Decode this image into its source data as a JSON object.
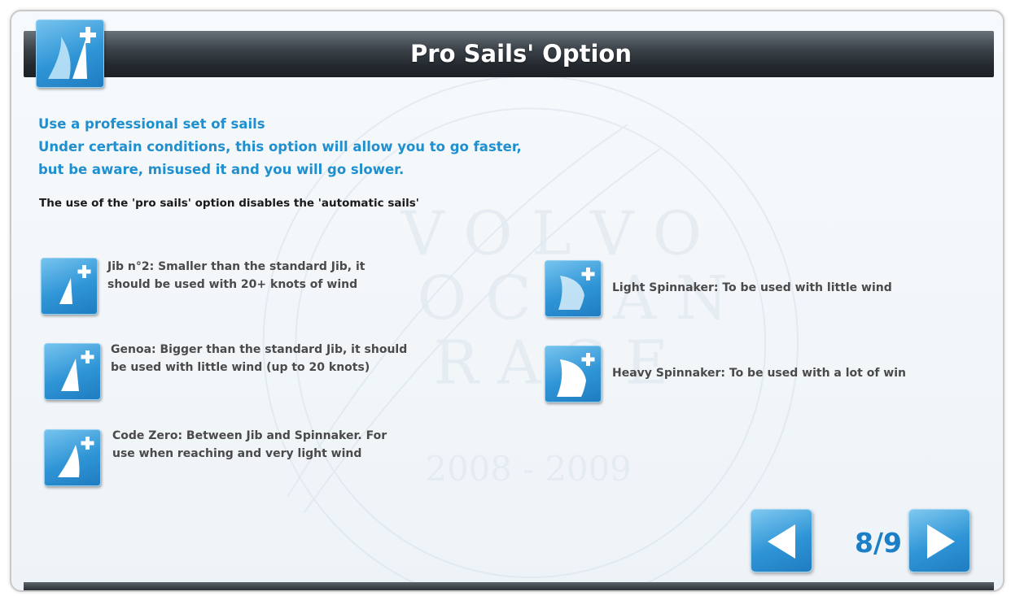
{
  "header": {
    "title": "Pro Sails' Option",
    "icon": "sail-plus-icon"
  },
  "intro": {
    "line1": "Use a professional set of sails",
    "line2": "Under certain conditions, this option will allow you to go faster,",
    "line3": "but be aware, misused it and you will go slower."
  },
  "note": "The use of the 'pro sails' option disables the 'automatic sails'",
  "sails_left": [
    {
      "icon": "jib-sail-icon",
      "line1": "Jib n°2: Smaller than the standard Jib, it",
      "line2": "should be used with 20+ knots of wind"
    },
    {
      "icon": "genoa-sail-icon",
      "line1": "Genoa: Bigger than the standard Jib, it should",
      "line2": "be used with little wind (up to 20 knots)"
    },
    {
      "icon": "code-zero-sail-icon",
      "line1": "Code Zero: Between Jib and Spinnaker. For",
      "line2": "use when reaching and very light wind"
    }
  ],
  "sails_right": [
    {
      "icon": "light-spinnaker-icon",
      "line1": "Light Spinnaker: To be used with little wind"
    },
    {
      "icon": "heavy-spinnaker-icon",
      "line1": "Heavy Spinnaker: To be used with a lot of win"
    }
  ],
  "pagination": {
    "current": "8/9",
    "prev_icon": "arrow-left-icon",
    "next_icon": "arrow-right-icon"
  },
  "colors": {
    "accent_blue": "#1f8fcf",
    "header_dark": "#23292e",
    "tile_blue": "#2f95d6"
  }
}
